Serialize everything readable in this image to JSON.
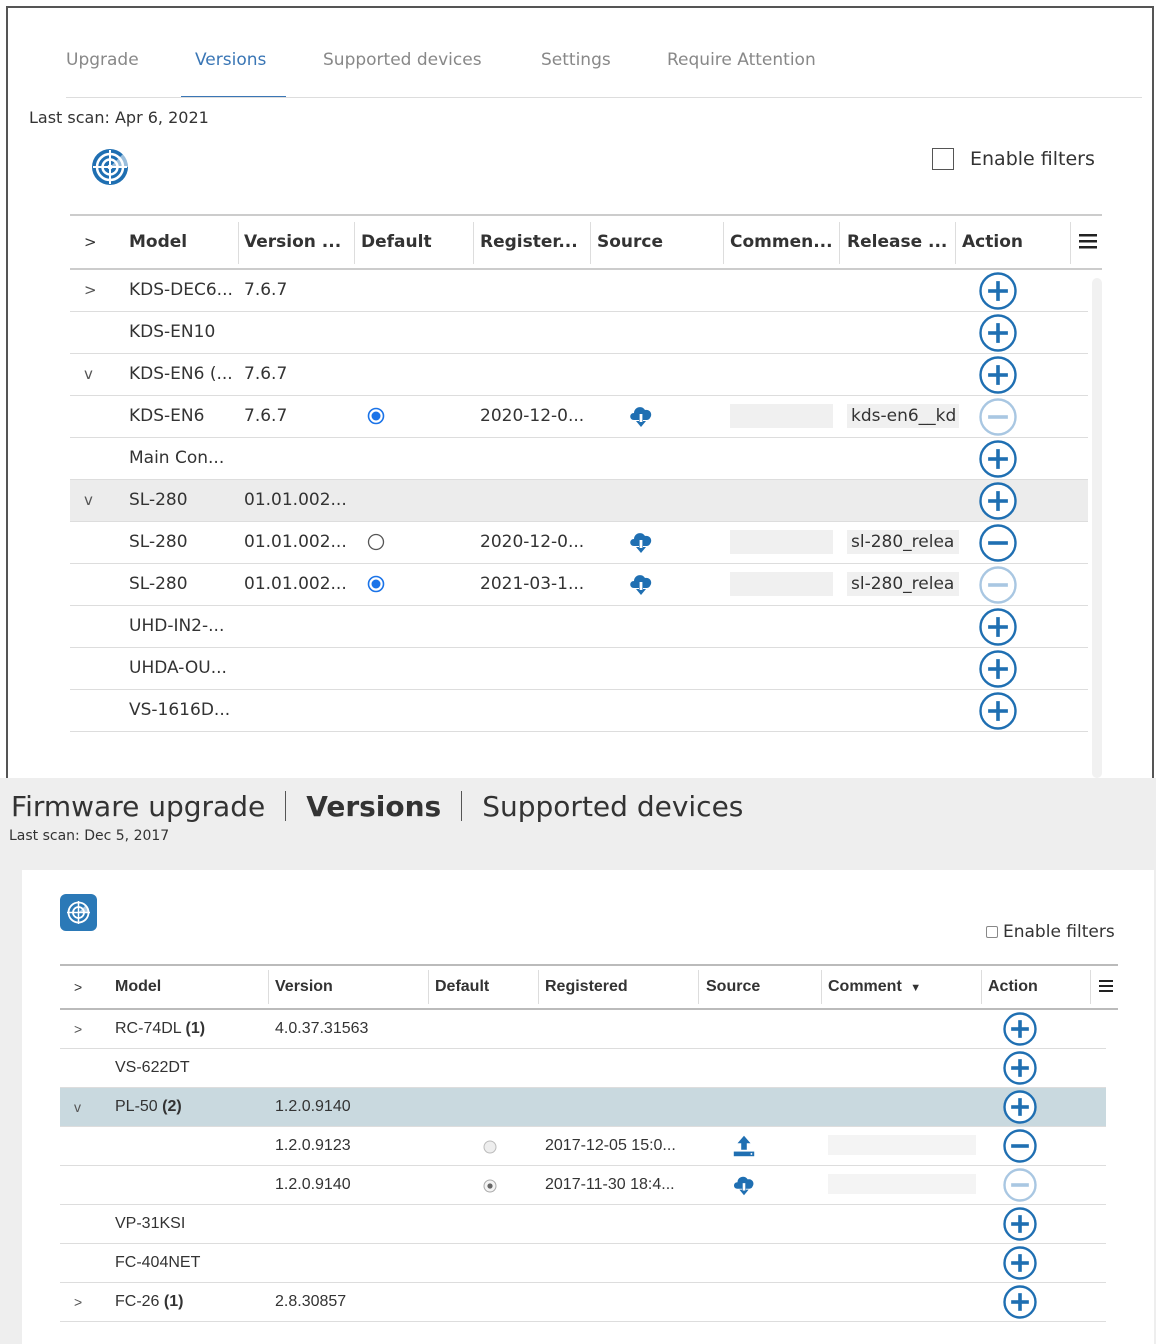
{
  "top": {
    "tabs": [
      {
        "label": "Upgrade",
        "active": false
      },
      {
        "label": "Versions",
        "active": true
      },
      {
        "label": "Supported devices",
        "active": false
      },
      {
        "label": "Settings",
        "active": false
      },
      {
        "label": "Require Attention",
        "active": false
      }
    ],
    "last_scan": "Last scan: Apr 6, 2021",
    "enable_filters_label": "Enable filters",
    "enable_filters_checked": false,
    "columns": [
      "Model",
      "Version ...",
      "Default",
      "Register...",
      "Source",
      "Commen...",
      "Release ...",
      "Action"
    ],
    "rows": [
      {
        "expander": ">",
        "model": "KDS-DEC6...",
        "version": "7.6.7",
        "default": null,
        "registered": "",
        "source": "",
        "comment": false,
        "release": "",
        "action": "add",
        "selected": false
      },
      {
        "expander": "",
        "model": "KDS-EN10",
        "version": "",
        "default": null,
        "registered": "",
        "source": "",
        "comment": false,
        "release": "",
        "action": "add",
        "selected": false
      },
      {
        "expander": "v",
        "model": "KDS-EN6 (...",
        "version": "7.6.7",
        "default": null,
        "registered": "",
        "source": "",
        "comment": false,
        "release": "",
        "action": "add",
        "selected": false
      },
      {
        "expander": "",
        "model": "KDS-EN6",
        "version": "7.6.7",
        "default": true,
        "registered": "2020-12-0...",
        "source": "cloud-download",
        "comment": true,
        "release": "kds-en6__kd",
        "action": "remove-disabled",
        "selected": false
      },
      {
        "expander": "",
        "model": "Main Con...",
        "version": "",
        "default": null,
        "registered": "",
        "source": "",
        "comment": false,
        "release": "",
        "action": "add",
        "selected": false
      },
      {
        "expander": "v",
        "model": "SL-280",
        "version": "01.01.002...",
        "default": null,
        "registered": "",
        "source": "",
        "comment": false,
        "release": "",
        "action": "add",
        "selected": true
      },
      {
        "expander": "",
        "model": "SL-280",
        "version": "01.01.002...",
        "default": false,
        "registered": "2020-12-0...",
        "source": "cloud-download",
        "comment": true,
        "release": "sl-280_relea",
        "action": "remove",
        "selected": false
      },
      {
        "expander": "",
        "model": "SL-280",
        "version": "01.01.002...",
        "default": true,
        "registered": "2021-03-1...",
        "source": "cloud-download",
        "comment": true,
        "release": "sl-280_relea",
        "action": "remove-disabled",
        "selected": false
      },
      {
        "expander": "",
        "model": "UHD-IN2-...",
        "version": "",
        "default": null,
        "registered": "",
        "source": "",
        "comment": false,
        "release": "",
        "action": "add",
        "selected": false
      },
      {
        "expander": "",
        "model": "UHDA-OU...",
        "version": "",
        "default": null,
        "registered": "",
        "source": "",
        "comment": false,
        "release": "",
        "action": "add",
        "selected": false
      },
      {
        "expander": "",
        "model": "VS-1616D...",
        "version": "",
        "default": null,
        "registered": "",
        "source": "",
        "comment": false,
        "release": "",
        "action": "add",
        "selected": false
      }
    ]
  },
  "bottom": {
    "title_parts": [
      "Firmware upgrade",
      "Versions",
      "Supported devices"
    ],
    "last_scan": "Last scan: Dec 5, 2017",
    "enable_filters_label": "Enable filters",
    "enable_filters_checked": false,
    "columns": [
      "Model",
      "Version",
      "Default",
      "Registered",
      "Source",
      "Comment",
      "Action"
    ],
    "comment_sort_icon": "caret-down-icon",
    "rows": [
      {
        "expander": ">",
        "model": "RC-74DL",
        "count": "(1)",
        "version": "4.0.37.31563",
        "default": null,
        "registered": "",
        "source": "",
        "comment": false,
        "action": "add",
        "selected": false
      },
      {
        "expander": "",
        "model": "VS-622DT",
        "count": "",
        "version": "",
        "default": null,
        "registered": "",
        "source": "",
        "comment": false,
        "action": "add",
        "selected": false
      },
      {
        "expander": "v",
        "model": "PL-50",
        "count": "(2)",
        "version": "1.2.0.9140",
        "default": null,
        "registered": "",
        "source": "",
        "comment": false,
        "action": "add",
        "selected": true
      },
      {
        "expander": "",
        "model": "",
        "count": "",
        "version": "1.2.0.9123",
        "default": false,
        "registered": "2017-12-05 15:0...",
        "source": "upload",
        "comment": true,
        "action": "remove",
        "selected": false
      },
      {
        "expander": "",
        "model": "",
        "count": "",
        "version": "1.2.0.9140",
        "default": true,
        "registered": "2017-11-30 18:4...",
        "source": "cloud-download",
        "comment": true,
        "action": "remove-disabled",
        "selected": false
      },
      {
        "expander": "",
        "model": "VP-31KSI",
        "count": "",
        "version": "",
        "default": null,
        "registered": "",
        "source": "",
        "comment": false,
        "action": "add",
        "selected": false
      },
      {
        "expander": "",
        "model": "FC-404NET",
        "count": "",
        "version": "",
        "default": null,
        "registered": "",
        "source": "",
        "comment": false,
        "action": "add",
        "selected": false
      },
      {
        "expander": ">",
        "model": "FC-26",
        "count": "(1)",
        "version": "2.8.30857",
        "default": null,
        "registered": "",
        "source": "",
        "comment": false,
        "action": "add",
        "selected": false
      }
    ]
  },
  "icons": {
    "radar": "radar-icon",
    "menu": "hamburger-menu-icon",
    "add": "plus-circle-icon",
    "remove": "minus-circle-icon",
    "cloud": "cloud-download-icon",
    "upload": "upload-icon"
  },
  "colors": {
    "accent": "#3a76b5",
    "icon_blue": "#1f6fb2",
    "disabled_blue": "#a9c7e2",
    "selected_row_top": "#ececec",
    "selected_row_bottom": "#c9d9df"
  }
}
